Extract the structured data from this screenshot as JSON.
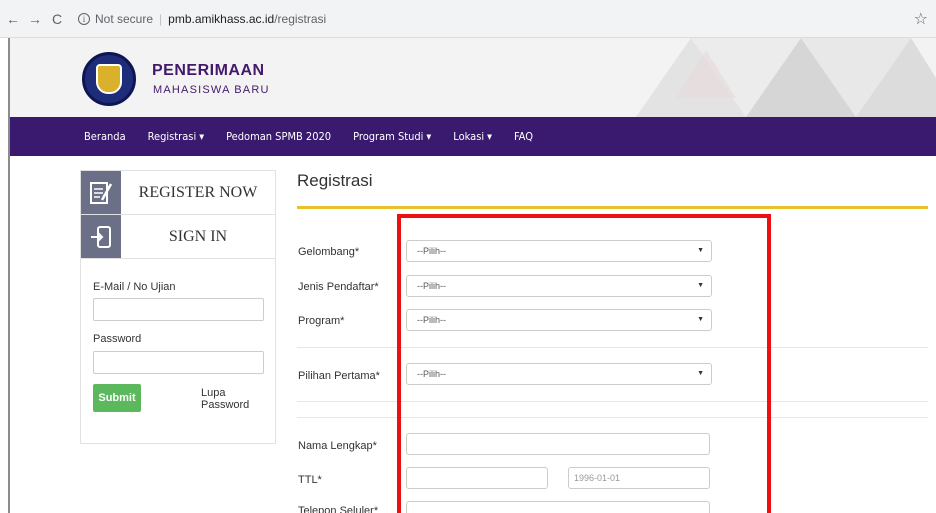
{
  "browser": {
    "back_icon": "←",
    "forward_icon": "→",
    "reload_icon": "C",
    "security_text": "Not secure",
    "url_host": "pmb.amikhass.ac.id",
    "url_path": "/registrasi",
    "star_icon": "☆"
  },
  "header": {
    "title": "PENERIMAAN",
    "subtitle": "MAHASISWA BARU"
  },
  "nav": {
    "items": [
      {
        "label": "Beranda",
        "dropdown": ""
      },
      {
        "label": "Registrasi",
        "dropdown": "▼"
      },
      {
        "label": "Pedoman SPMB 2020",
        "dropdown": ""
      },
      {
        "label": "Program Studi",
        "dropdown": "▼"
      },
      {
        "label": "Lokasi",
        "dropdown": "▼"
      },
      {
        "label": "FAQ",
        "dropdown": ""
      }
    ]
  },
  "sidebar": {
    "register_label": "REGISTER NOW",
    "signin_label": "SIGN IN",
    "email_label": "E-Mail / No Ujian",
    "email_value": "",
    "password_label": "Password",
    "password_value": "",
    "submit_label": "Submit",
    "forgot_label": "Lupa Password"
  },
  "form": {
    "title": "Registrasi",
    "fields": {
      "gelombang": {
        "label": "Gelombang*",
        "value": "--Pilih--"
      },
      "jenis_pendaftar": {
        "label": "Jenis Pendaftar*",
        "value": "--Pilih--"
      },
      "program": {
        "label": "Program*",
        "value": "--Pilih--"
      },
      "pilihan_pertama": {
        "label": "Pilihan Pertama*",
        "value": "--Pilih--"
      },
      "nama_lengkap": {
        "label": "Nama Lengkap*",
        "value": ""
      },
      "ttl": {
        "label": "TTL*",
        "place_value": "",
        "date_value": "1996-01-01"
      },
      "telepon": {
        "label": "Telepon Seluler*",
        "value": ""
      }
    },
    "select_arrow": "▼"
  },
  "colors": {
    "nav_bg": "#3a1a6e",
    "brand_text": "#43196b",
    "accent_rule": "#e8c22c",
    "submit_green": "#5cb85c",
    "highlight_red": "#ee1010"
  }
}
